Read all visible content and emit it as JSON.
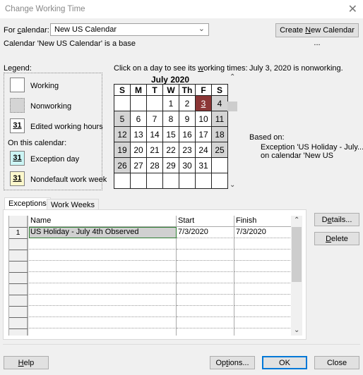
{
  "window": {
    "title": "Change Working Time",
    "close_glyph": "✕"
  },
  "for_calendar": {
    "label_pre": "For ",
    "label_key": "c",
    "label_post": "alendar:",
    "value": "New US Calendar",
    "status": "Calendar 'New US Calendar' is a base"
  },
  "buttons": {
    "create_new_pre": "Create ",
    "create_new_key": "N",
    "create_new_post": "ew Calendar ...",
    "details_pre": "D",
    "details_key": "e",
    "details_post": "tails...",
    "delete_key": "D",
    "delete_post": "elete",
    "help_key": "H",
    "help_post": "elp",
    "options_pre": "Op",
    "options_key": "t",
    "options_post": "ions...",
    "ok": "OK",
    "close": "Close"
  },
  "legend": {
    "title": "Legend:",
    "items": [
      {
        "label": "Working",
        "swatch": "",
        "color": "#ffffff"
      },
      {
        "label": "Nonworking",
        "swatch": "",
        "color": "#d4d4d4"
      },
      {
        "label": "Edited working hours",
        "swatch": "31",
        "color": "#ffffff"
      }
    ],
    "on_this_calendar": "On this calendar:",
    "calendar_items": [
      {
        "label": "Exception day",
        "swatch": "31",
        "color": "#ccf5f5"
      },
      {
        "label": "Nondefault work week",
        "swatch": "31",
        "color": "#fdf8cc"
      }
    ]
  },
  "calendar": {
    "instruction_pre": "Click on a day to see its ",
    "instruction_key": "w",
    "instruction_post": "orking times:",
    "month_title": "July 2020",
    "weekdays": [
      "S",
      "M",
      "T",
      "W",
      "Th",
      "F",
      "S"
    ],
    "selected_day": "3",
    "selected_color": "#8b3636",
    "weeks": [
      [
        "",
        "",
        "",
        "1",
        "2",
        "3",
        "4"
      ],
      [
        "5",
        "6",
        "7",
        "8",
        "9",
        "10",
        "11"
      ],
      [
        "12",
        "13",
        "14",
        "15",
        "16",
        "17",
        "18"
      ],
      [
        "19",
        "20",
        "21",
        "22",
        "23",
        "24",
        "25"
      ],
      [
        "26",
        "27",
        "28",
        "29",
        "30",
        "31",
        ""
      ],
      [
        "",
        "",
        "",
        "",
        "",
        "",
        ""
      ]
    ]
  },
  "day_info": {
    "status": "July 3, 2020 is nonworking.",
    "based_on": "Based on:",
    "detail_line1": "Exception 'US Holiday - July...'",
    "detail_line2": "on calendar 'New US"
  },
  "tabs": [
    {
      "label": "Exceptions",
      "active": true
    },
    {
      "label": "Work Weeks",
      "active": false
    }
  ],
  "exceptions_table": {
    "columns": [
      "Name",
      "Start",
      "Finish"
    ],
    "rows": [
      {
        "num": "1",
        "name": "US Holiday - July 4th Observed",
        "start": "7/3/2020",
        "finish": "7/3/2020"
      }
    ],
    "empty_rows": 9
  }
}
